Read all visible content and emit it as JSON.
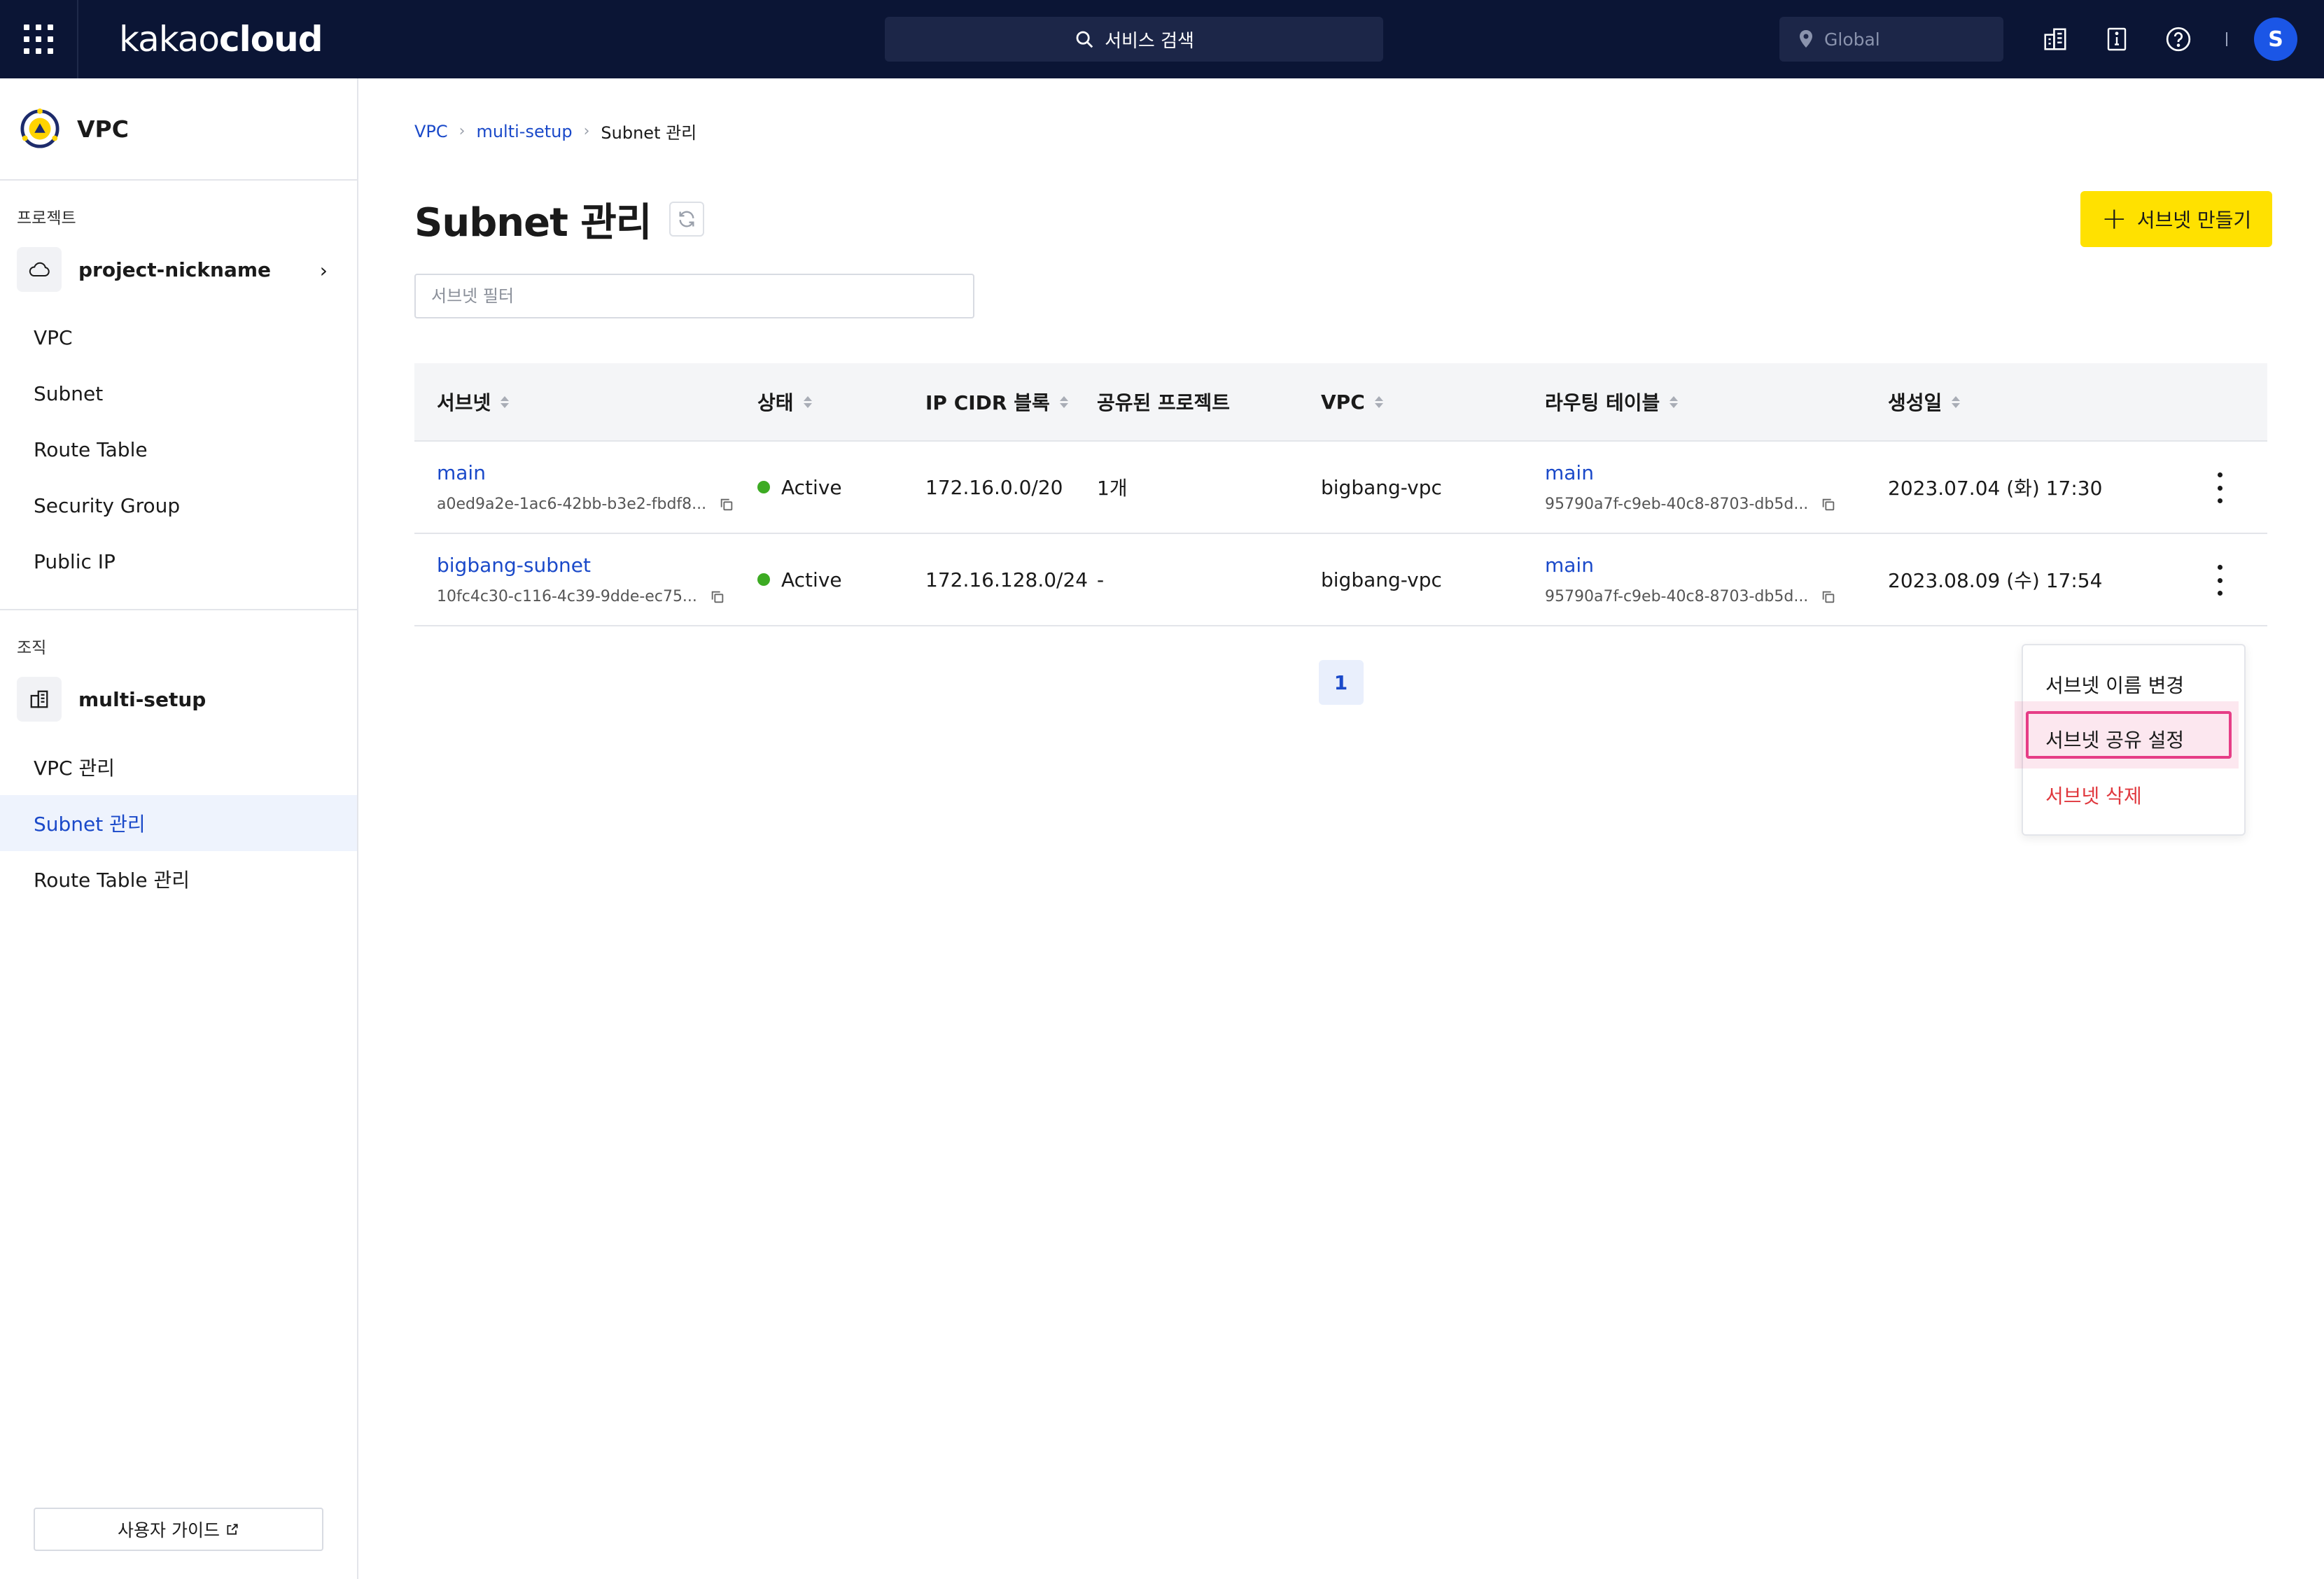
{
  "topbar": {
    "logo_part1": "kakao",
    "logo_part2": "cloud",
    "search_placeholder": "서비스 검색",
    "region": "Global",
    "avatar_initial": "S",
    "bg_color": "#0b1535"
  },
  "sidebar": {
    "service_title": "VPC",
    "project_label": "프로젝트",
    "project_name": "project-nickname",
    "project_items": [
      "VPC",
      "Subnet",
      "Route Table",
      "Security Group",
      "Public IP"
    ],
    "org_label": "조직",
    "org_name": "multi-setup",
    "org_items": [
      "VPC 관리",
      "Subnet 관리",
      "Route Table 관리"
    ],
    "active_item": "Subnet 관리",
    "guide_label": "사용자 가이드"
  },
  "main": {
    "breadcrumb": [
      "VPC",
      "multi-setup",
      "Subnet 관리"
    ],
    "title": "Subnet 관리",
    "create_button": "서브넷 만들기",
    "filter_placeholder": "서브넷 필터",
    "accent_color": "#ffe100",
    "link_color": "#1a49c9"
  },
  "table": {
    "headers": [
      "서브넷",
      "상태",
      "IP CIDR 블록",
      "공유된 프로젝트",
      "VPC",
      "라우팅 테이블",
      "생성일"
    ],
    "rows": [
      {
        "name": "main",
        "id": "a0ed9a2e-1ac6-42bb-b3e2-fbdf8...",
        "status": "Active",
        "cidr": "172.16.0.0/20",
        "shared": "1개",
        "vpc": "bigbang-vpc",
        "route_table": "main",
        "route_table_id": "95790a7f-c9eb-40c8-8703-db5d...",
        "created": "2023.07.04 (화) 17:30"
      },
      {
        "name": "bigbang-subnet",
        "id": "10fc4c30-c116-4c39-9dde-ec75...",
        "status": "Active",
        "cidr": "172.16.128.0/24",
        "shared": "-",
        "vpc": "bigbang-vpc",
        "route_table": "main",
        "route_table_id": "95790a7f-c9eb-40c8-8703-db5d...",
        "created": "2023.08.09 (수) 17:54"
      }
    ],
    "status_color": "#3dab23"
  },
  "pagination": {
    "current": "1"
  },
  "context_menu": {
    "items": [
      "서브넷 이름 변경",
      "서브넷 공유 설정",
      "서브넷 삭제"
    ],
    "highlighted": "서브넷 공유 설정",
    "danger_color": "#e0383e"
  }
}
